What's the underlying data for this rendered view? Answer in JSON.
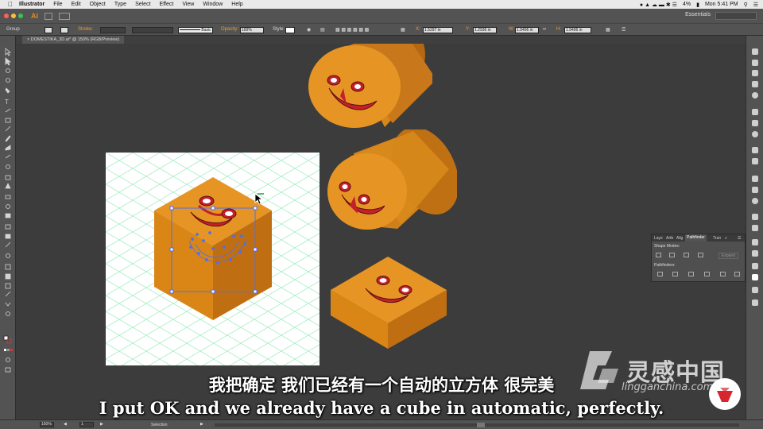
{
  "menubar": {
    "apple_icon": "apple-icon",
    "items": [
      "Illustrator",
      "File",
      "Edit",
      "Object",
      "Type",
      "Select",
      "Effect",
      "View",
      "Window",
      "Help"
    ],
    "battery": "4%",
    "clock": "Mon 5:41 PM"
  },
  "appbar": {
    "logo": "Ai",
    "workspace": "Essentials"
  },
  "controlbar": {
    "selection_type": "Group",
    "stroke_label": "Stroke:",
    "brush": "Basic",
    "opacity_label": "Opacity:",
    "opacity_value": "100%",
    "style_label": "Style:",
    "x_label": "X:",
    "x_value": "1.5297 in",
    "y_label": "Y:",
    "y_value": "1.2936 in",
    "w_label": "W:",
    "w_value": "1.9406 in",
    "h_label": "H:",
    "h_value": "1.9406 in"
  },
  "document": {
    "tab_title": "DOMESTIKA_3D.ai* @ 150% (RGB/Preview)"
  },
  "pathfinder_panel": {
    "tabs": [
      "Laye",
      "Artb",
      "Alig",
      "Pathfinder",
      "Tran"
    ],
    "active_tab": "Pathfinder",
    "shape_modes_label": "Shape Modes:",
    "expand_label": "Expand",
    "pathfinders_label": "Pathfinders:"
  },
  "statusbar": {
    "zoom": "150%",
    "page": "1",
    "tool_name": "Selection"
  },
  "subtitles": {
    "chinese": "我把确定 我们已经有一个自动的立方体 很完美",
    "english": "I put OK and we already have a cube in automatic, perfectly."
  },
  "watermark": {
    "brand_cn": "灵感中国",
    "brand_url": "lingganchina.com"
  },
  "colors": {
    "ui_panel": "#535353",
    "canvas_bg": "#3c3c3c",
    "cube_top": "#e69524",
    "cube_left": "#d07e16",
    "cube_right": "#b8690f",
    "grid_line": "#7fe0a8",
    "selection": "#4f6ff0"
  }
}
